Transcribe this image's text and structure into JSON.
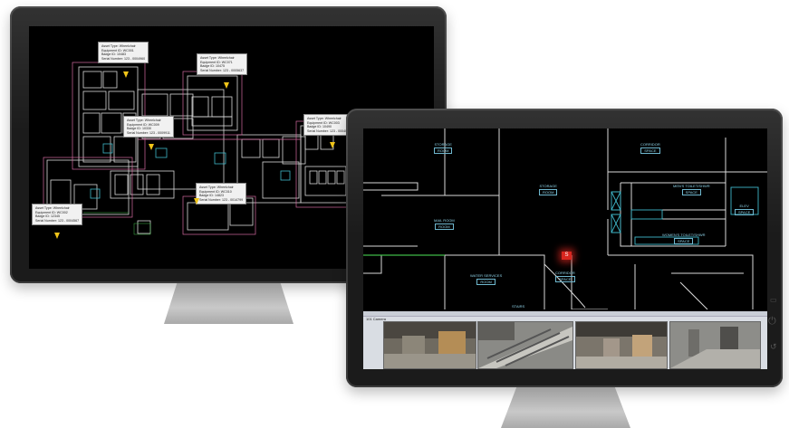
{
  "left_monitor": {
    "tooltips": [
      {
        "lines": [
          "Asset Type: Wheelchair",
          "Equipment ID: WC001",
          "Badge ID: 10483",
          "Serial Number: 123 - 0004960"
        ]
      },
      {
        "lines": [
          "Asset Type: Wheelchair",
          "Equipment ID: WC071",
          "Badge ID: 10475",
          "Serial Number: 123 - 0005637"
        ]
      },
      {
        "lines": [
          "Asset Type: Wheelchair",
          "Equipment ID: WC009",
          "Badge ID: 10330",
          "Serial Number: 123 - 0009911"
        ]
      },
      {
        "lines": [
          "Asset Type: Wheelchair",
          "Equipment ID: WC003",
          "Badge ID: 10490",
          "Serial Number: 123 - 0004033"
        ]
      },
      {
        "lines": [
          "Asset Type: Wheelchair",
          "Equipment ID: WC010",
          "Badge ID: 14823",
          "Serial Number: 123 - 0014799"
        ]
      },
      {
        "lines": [
          "Asset Type: Wheelchair",
          "Equipment ID: WC002",
          "Badge ID: 12345",
          "Serial Number: 123 - 0004567"
        ]
      }
    ]
  },
  "right_monitor": {
    "rooms": [
      {
        "name": "STORAGE",
        "tag": "ROOM"
      },
      {
        "name": "CORRIDOR",
        "tag": "SPACE"
      },
      {
        "name": "STORAGE",
        "tag": "ROOM"
      },
      {
        "name": "MEN'S TOILET/SHWR",
        "tag": "SPACE"
      },
      {
        "name": "ELEV",
        "tag": "SPACE"
      },
      {
        "name": "MAIL ROOM",
        "tag": "ROOM"
      },
      {
        "name": "WOMEN'S TOILET/SHWR",
        "tag": "SPACE"
      },
      {
        "name": "CORRIDOR",
        "tag": "SPACE"
      },
      {
        "name": "WATER SERVICES",
        "tag": "ROOM"
      },
      {
        "name": "STAIRS",
        "tag": ""
      }
    ],
    "alarm_marker": "S",
    "camera_panel_title": "101 Camera",
    "cameras": [
      {
        "name": "camera-feed-1"
      },
      {
        "name": "camera-feed-2"
      },
      {
        "name": "camera-feed-3"
      },
      {
        "name": "camera-feed-4"
      }
    ]
  },
  "colors": {
    "floorplan_walls": "#d9d9d9",
    "accent_pink": "#d46aa0",
    "accent_cyan": "#3fb7c9",
    "pin_yellow": "#f0c419",
    "alarm_red": "#d8261f"
  }
}
